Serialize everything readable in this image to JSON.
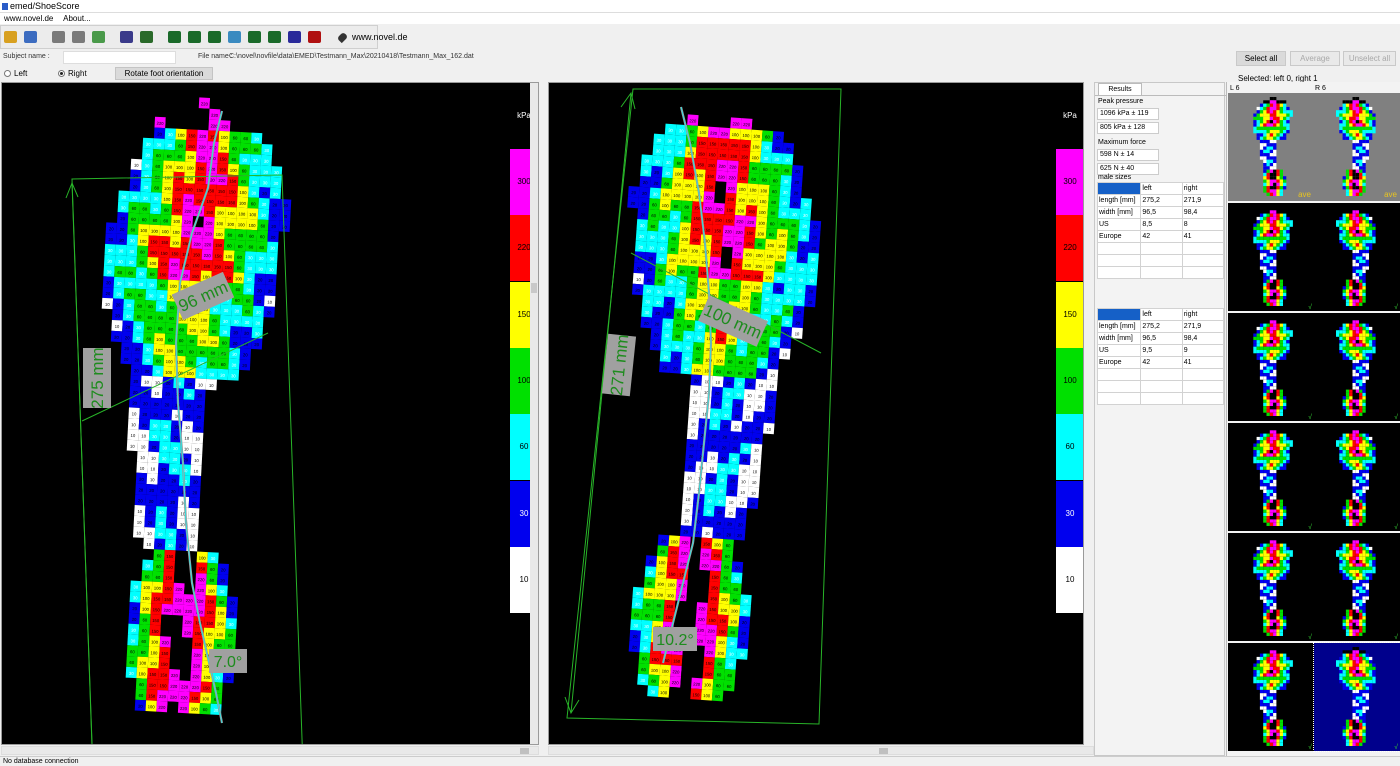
{
  "window": {
    "title": "emed/ShoeScore"
  },
  "menu": {
    "items": [
      "www.novel.de",
      "About..."
    ]
  },
  "toolbar": {
    "link_label": "www.novel.de",
    "icons": [
      "open-icon",
      "save-icon",
      "print-icon",
      "print-preview-icon",
      "export-icon",
      "pressure-icon",
      "foot-icon",
      "evaluation-1-icon",
      "evaluation-2-icon",
      "evaluation-3-icon",
      "overlay-icon",
      "evaluation-4-icon",
      "evaluation-5-icon",
      "mpc-icon",
      "report-icon"
    ]
  },
  "subject": {
    "label": "Subject name :",
    "value": ""
  },
  "file": {
    "label": "File name :",
    "path": "C:\\novel\\novfile\\data\\EMED\\Testmann_Max\\20210418\\Testmann_Max_162.dat"
  },
  "buttons": {
    "select_all": "Select all",
    "average": "Average",
    "unselect_all": "Unselect all",
    "rotate": "Rotate foot orientation"
  },
  "orientation": {
    "left_label": "Left",
    "right_label": "Right",
    "selected": "right"
  },
  "selection": {
    "label": "Selected: left 0, right 1"
  },
  "scale": {
    "unit": "kPa",
    "levels": [
      {
        "label": "300",
        "color": "#ff00ff"
      },
      {
        "label": "220",
        "color": "#ff0000"
      },
      {
        "label": "150",
        "color": "#ffff00"
      },
      {
        "label": "100",
        "color": "#00e000"
      },
      {
        "label": "60",
        "color": "#00ffff"
      },
      {
        "label": "30",
        "color": "#0000ee"
      },
      {
        "label": "10",
        "color": "#ffffff"
      }
    ],
    "colors": {
      "zero": "#000000",
      "box": "#28b428",
      "label_bg": "#a0a0a0",
      "label_text": "#1e8c1e"
    }
  },
  "left_foot": {
    "length_label": "275 mm",
    "width_label": "96 mm",
    "angle_label": "7.0°"
  },
  "right_foot": {
    "length_label": "271 mm",
    "width_label": "100 mm",
    "angle_label": "10.2°"
  },
  "results": {
    "tab": "Results",
    "peak_pressure_label": "Peak pressure",
    "peak_pressure": [
      "1096 kPa ± 119",
      "805 kPa ± 128"
    ],
    "max_force_label": "Maximum force",
    "max_force": [
      "598 N ± 14",
      "625 N ± 40"
    ],
    "sizes_label": "male sizes",
    "table1": {
      "header": [
        "",
        "left",
        "right"
      ],
      "rows": [
        [
          "length [mm]",
          "275,2",
          "271,9"
        ],
        [
          "width [mm]",
          "96,5",
          "98,4"
        ],
        [
          "US",
          "8,5",
          "8"
        ],
        [
          "Europe",
          "42",
          "41"
        ]
      ]
    },
    "table2": {
      "header": [
        "",
        "left",
        "right"
      ],
      "rows": [
        [
          "length [mm]",
          "275,2",
          "271,9"
        ],
        [
          "width [mm]",
          "96,5",
          "98,4"
        ],
        [
          "US",
          "9,5",
          "9"
        ],
        [
          "Europe",
          "42",
          "41"
        ]
      ]
    }
  },
  "thumbnails": {
    "left_head": "L 6",
    "right_head": "R 6",
    "ave_label": "ave",
    "check": "√"
  },
  "status": {
    "text": "No database connection"
  }
}
